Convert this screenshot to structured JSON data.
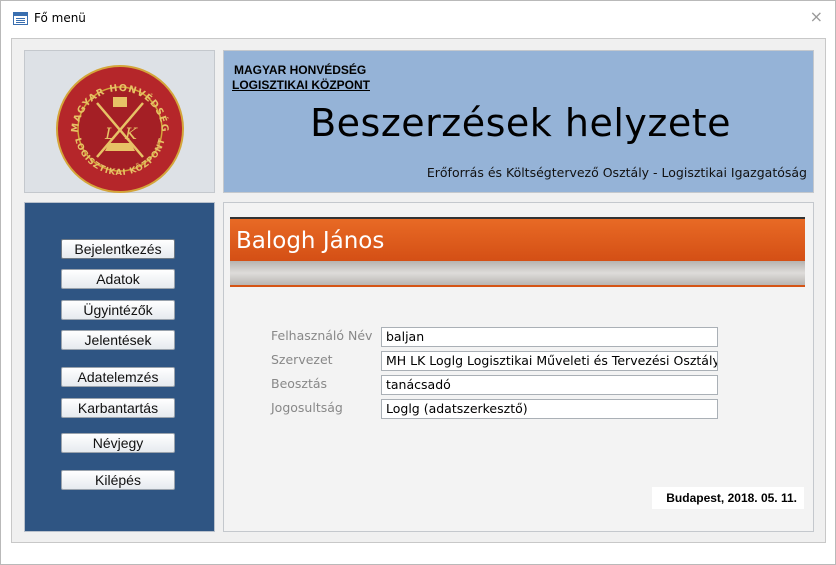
{
  "window": {
    "title": "Fő menü",
    "close_label": "×"
  },
  "logo": {
    "text_top": "MAGYAR HONVÉDSÉG",
    "text_bottom": "LOGISZTIKAI KÖZPONT",
    "monogram_l": "L",
    "monogram_k": "K"
  },
  "header": {
    "org_line1": "MAGYAR HONVÉDSÉG",
    "org_line2": "LOGISZTIKAI KÖZPONT",
    "title": "Beszerzések helyzete",
    "subtitle": "Erőforrás és Költségtervező Osztály - Logisztikai Igazgatóság"
  },
  "nav": {
    "items": [
      {
        "label": "Bejelentkezés"
      },
      {
        "label": "Adatok"
      },
      {
        "label": "Ügyintézők"
      },
      {
        "label": "Jelentések"
      },
      {
        "label": "Adatelemzés"
      },
      {
        "label": "Karbantartás"
      },
      {
        "label": "Névjegy"
      },
      {
        "label": "Kilépés"
      }
    ]
  },
  "profile": {
    "name": "Balogh János",
    "fields": [
      {
        "label": "Felhasználó Név",
        "value": "baljan"
      },
      {
        "label": "Szervezet",
        "value": "MH LK Loglg  Logisztikai Műveleti és Tervezési Osztály"
      },
      {
        "label": "Beosztás",
        "value": "tanácsadó"
      },
      {
        "label": "Jogosultság",
        "value": "Loglg (adatszerkesztő)"
      }
    ],
    "date": "Budapest, 2018. 05. 11."
  },
  "colors": {
    "nav_bg": "#2f5583",
    "header_bg": "#95b3d7",
    "name_bar": "#e05d1d",
    "logo_red": "#b5262a"
  }
}
